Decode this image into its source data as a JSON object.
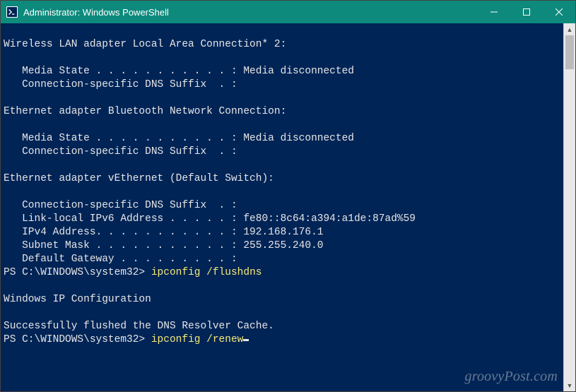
{
  "titlebar": {
    "title": "Administrator: Windows PowerShell",
    "colors": {
      "bg": "#0e8a7d",
      "fg": "#ffffff"
    }
  },
  "terminal": {
    "colors": {
      "bg": "#012456",
      "fg": "#e6e6e6",
      "cmd": "#f5e97a"
    },
    "lines": [
      {
        "type": "blank",
        "text": ""
      },
      {
        "type": "out",
        "text": "Wireless LAN adapter Local Area Connection* 2:"
      },
      {
        "type": "blank",
        "text": ""
      },
      {
        "type": "out",
        "text": "   Media State . . . . . . . . . . . : Media disconnected"
      },
      {
        "type": "out",
        "text": "   Connection-specific DNS Suffix  . :"
      },
      {
        "type": "blank",
        "text": ""
      },
      {
        "type": "out",
        "text": "Ethernet adapter Bluetooth Network Connection:"
      },
      {
        "type": "blank",
        "text": ""
      },
      {
        "type": "out",
        "text": "   Media State . . . . . . . . . . . : Media disconnected"
      },
      {
        "type": "out",
        "text": "   Connection-specific DNS Suffix  . :"
      },
      {
        "type": "blank",
        "text": ""
      },
      {
        "type": "out",
        "text": "Ethernet adapter vEthernet (Default Switch):"
      },
      {
        "type": "blank",
        "text": ""
      },
      {
        "type": "out",
        "text": "   Connection-specific DNS Suffix  . :"
      },
      {
        "type": "out",
        "text": "   Link-local IPv6 Address . . . . . : fe80::8c64:a394:a1de:87ad%59"
      },
      {
        "type": "out",
        "text": "   IPv4 Address. . . . . . . . . . . : 192.168.176.1"
      },
      {
        "type": "out",
        "text": "   Subnet Mask . . . . . . . . . . . : 255.255.240.0"
      },
      {
        "type": "out",
        "text": "   Default Gateway . . . . . . . . . :"
      },
      {
        "type": "cmd",
        "prompt": "PS C:\\WINDOWS\\system32> ",
        "command": "ipconfig /flushdns"
      },
      {
        "type": "blank",
        "text": ""
      },
      {
        "type": "out",
        "text": "Windows IP Configuration"
      },
      {
        "type": "blank",
        "text": ""
      },
      {
        "type": "out",
        "text": "Successfully flushed the DNS Resolver Cache."
      },
      {
        "type": "cmd",
        "prompt": "PS C:\\WINDOWS\\system32> ",
        "command": "ipconfig /renew",
        "cursor": true
      }
    ]
  },
  "watermark": "groovyPost.com"
}
